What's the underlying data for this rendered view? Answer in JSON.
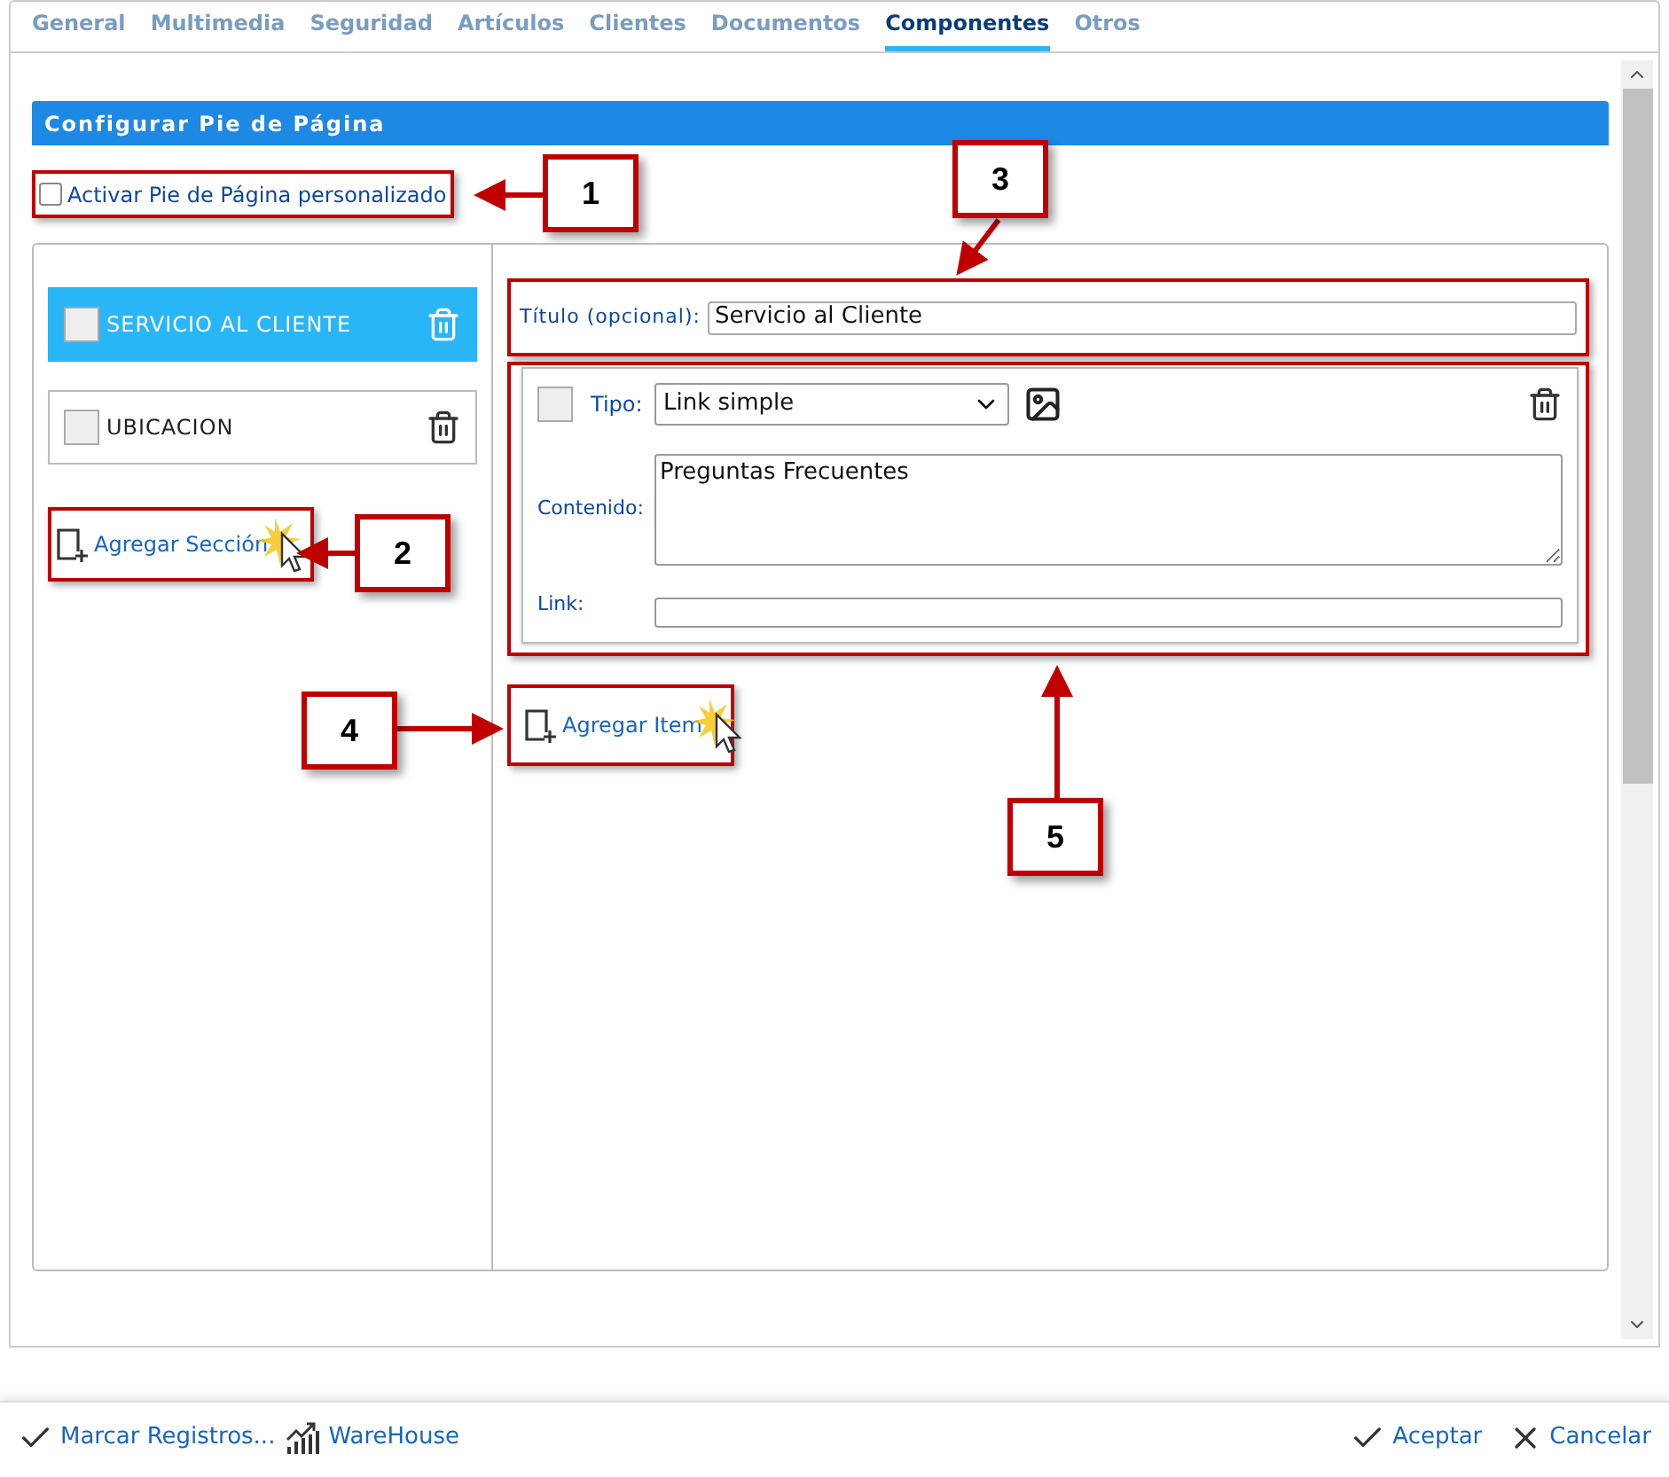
{
  "tabs": [
    {
      "label": "General",
      "selected": false
    },
    {
      "label": "Multimedia",
      "selected": false
    },
    {
      "label": "Seguridad",
      "selected": false
    },
    {
      "label": "Artículos",
      "selected": false
    },
    {
      "label": "Clientes",
      "selected": false
    },
    {
      "label": "Documentos",
      "selected": false
    },
    {
      "label": "Componentes",
      "selected": true
    },
    {
      "label": "Otros",
      "selected": false
    }
  ],
  "section_header": {
    "title": "Configurar Pie de Página"
  },
  "custom_footer": {
    "label": "Activar Pie de Página personalizado",
    "checked": false
  },
  "sections": [
    {
      "name": "SERVICIO AL CLIENTE",
      "selected": true,
      "checked": false
    },
    {
      "name": "UBICACION",
      "selected": false,
      "checked": false
    }
  ],
  "add_section": {
    "label": "Agregar Sección"
  },
  "title_field": {
    "label": "Título (opcional):",
    "value": "Servicio al Cliente"
  },
  "items": [
    {
      "checked": false,
      "type_label": "Tipo:",
      "type_value": "Link simple",
      "content_label": "Contenido:",
      "content_value": "Preguntas Frecuentes",
      "link_label": "Link:"
    }
  ],
  "add_item": {
    "label": "Agregar Item"
  },
  "callouts": [
    "1",
    "2",
    "3",
    "4",
    "5"
  ],
  "footer": {
    "left": [
      {
        "kind": "check",
        "label": "Marcar Registros..."
      },
      {
        "kind": "chart",
        "label": "WareHouse"
      }
    ],
    "right": [
      {
        "kind": "check",
        "label": "Aceptar"
      },
      {
        "kind": "close",
        "label": "Cancelar"
      }
    ]
  }
}
